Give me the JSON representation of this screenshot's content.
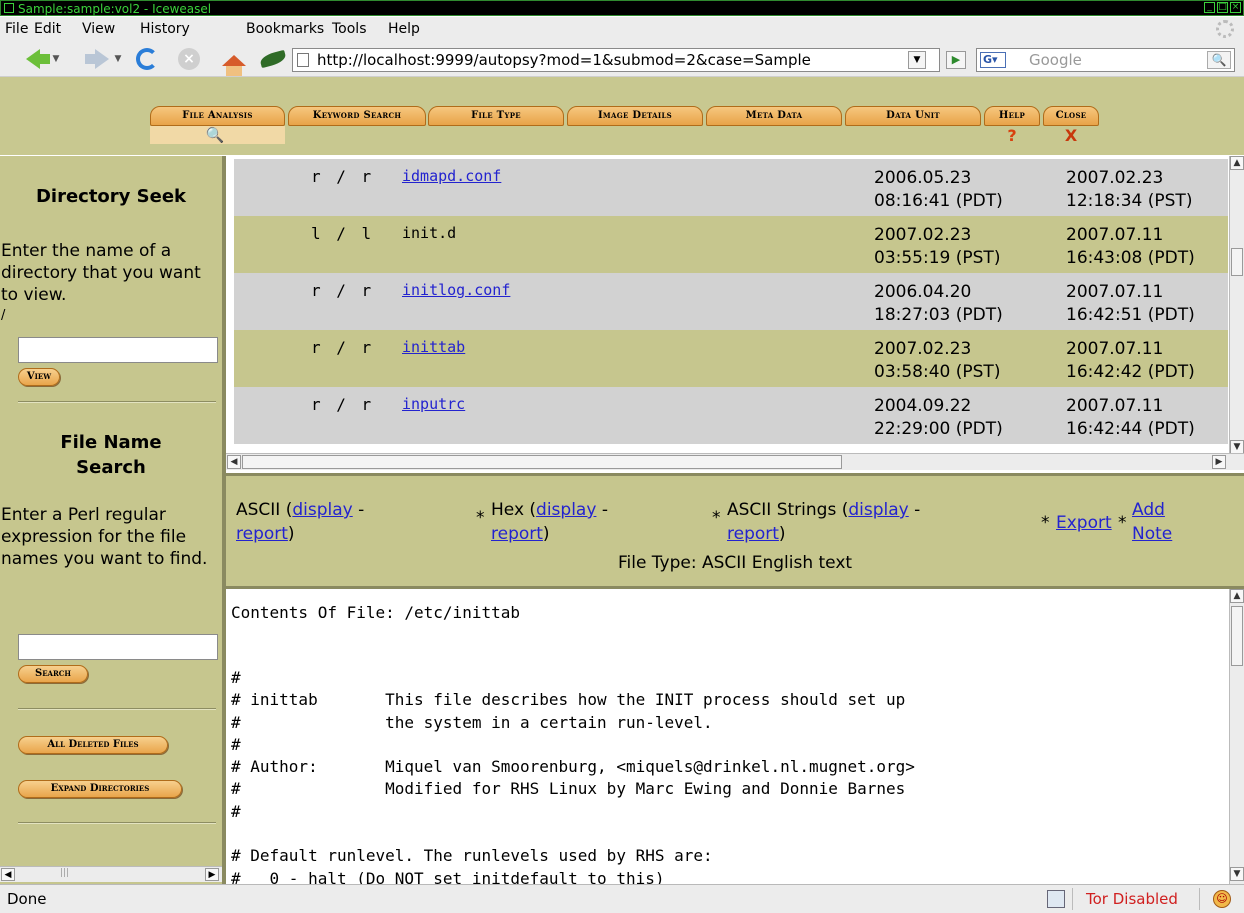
{
  "window": {
    "title": "Sample:sample:vol2 - Iceweasel"
  },
  "menubar": {
    "items": [
      "File",
      "Edit",
      "View",
      "History",
      "Bookmarks",
      "Tools",
      "Help"
    ]
  },
  "navbar": {
    "url": "http://localhost:9999/autopsy?mod=1&submod=2&case=Sample",
    "search_placeholder": "Google",
    "search_engine_label": "G"
  },
  "tabs": [
    {
      "label": "File Analysis",
      "active": true
    },
    {
      "label": "Keyword Search"
    },
    {
      "label": "File Type"
    },
    {
      "label": "Image Details"
    },
    {
      "label": "Meta Data"
    },
    {
      "label": "Data Unit"
    },
    {
      "label": "Help",
      "marker": "?"
    },
    {
      "label": "Close",
      "marker": "X"
    }
  ],
  "sidebar": {
    "dir_seek": {
      "title": "Directory Seek",
      "description": "Enter the name of a directory that you want to view.",
      "current": "/",
      "button": "View"
    },
    "name_search": {
      "title": "File Name Search",
      "description": "Enter a Perl regular expression for the file names you want to find.",
      "button": "Search"
    },
    "all_deleted_button": "All Deleted Files",
    "expand_dirs_button": "Expand Directories"
  },
  "file_list": {
    "rows": [
      {
        "type": "r / r",
        "name": "idmapd.conf",
        "link": true,
        "d1_date": "2006.05.23",
        "d1_time": "08:16:41 (PDT)",
        "d2_date": "2007.02.23",
        "d2_time": "12:18:34 (PST)"
      },
      {
        "type": "l / l",
        "name": "init.d",
        "link": false,
        "d1_date": "2007.02.23",
        "d1_time": "03:55:19 (PST)",
        "d2_date": "2007.07.11",
        "d2_time": "16:43:08 (PDT)"
      },
      {
        "type": "r / r",
        "name": "initlog.conf",
        "link": true,
        "d1_date": "2006.04.20",
        "d1_time": "18:27:03 (PDT)",
        "d2_date": "2007.07.11",
        "d2_time": "16:42:51 (PDT)"
      },
      {
        "type": "r / r",
        "name": "inittab",
        "link": true,
        "d1_date": "2007.02.23",
        "d1_time": "03:58:40 (PST)",
        "d2_date": "2007.07.11",
        "d2_time": "16:42:42 (PDT)"
      },
      {
        "type": "r / r",
        "name": "inputrc",
        "link": true,
        "d1_date": "2004.09.22",
        "d1_time": "22:29:00 (PDT)",
        "d2_date": "2007.07.11",
        "d2_time": "16:42:44 (PDT)"
      }
    ]
  },
  "view_options": {
    "ascii_label": "ASCII (",
    "hex_label": "Hex (",
    "strings_label": "ASCII Strings (",
    "display": "display",
    "report": "report",
    "sep": " -",
    "close": ")",
    "export": "Export",
    "add_note_line1": "Add",
    "add_note_line2": "Note",
    "file_type": "File Type: ASCII English text"
  },
  "content": {
    "title": "Contents Of File: /etc/inittab",
    "lines": [
      "#",
      "# inittab       This file describes how the INIT process should set up",
      "#               the system in a certain run-level.",
      "#",
      "# Author:       Miquel van Smoorenburg, <miquels@drinkel.nl.mugnet.org>",
      "#               Modified for RHS Linux by Marc Ewing and Donnie Barnes",
      "#",
      "",
      "# Default runlevel. The runlevels used by RHS are:",
      "#   0 - halt (Do NOT set initdefault to this)"
    ]
  },
  "status": {
    "text": "Done",
    "tor": "Tor Disabled"
  },
  "colors": {
    "panel": "#c6c68e",
    "tab": "#e8a348",
    "link": "#2323cf",
    "tor": "#d02020"
  }
}
